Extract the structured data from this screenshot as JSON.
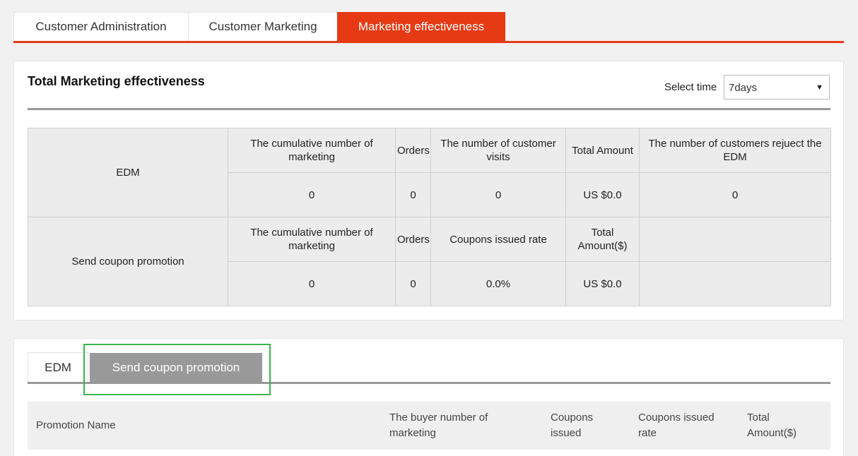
{
  "top_tabs": [
    {
      "label": "Customer Administration",
      "active": false
    },
    {
      "label": "Customer Marketing",
      "active": false
    },
    {
      "label": "Marketing effectiveness",
      "active": true
    }
  ],
  "summary_panel": {
    "title": "Total Marketing effectiveness",
    "select_label": "Select time",
    "select_value": "7days"
  },
  "summary_table": {
    "edm": {
      "label": "EDM",
      "headers": [
        "The cumulative number of marketing",
        "Orders",
        "The number of customer visits",
        "Total Amount",
        "The number of customers rejuect the EDM"
      ],
      "values": [
        "0",
        "0",
        "0",
        "US $0.0",
        "0"
      ]
    },
    "coupon": {
      "label": "Send coupon promotion",
      "headers": [
        "The cumulative number of marketing",
        "Orders",
        "Coupons issued rate",
        "Total Amount($)",
        ""
      ],
      "values": [
        "0",
        "0",
        "0.0%",
        "US $0.0",
        ""
      ]
    }
  },
  "detail_panel": {
    "tabs": [
      {
        "label": "EDM",
        "active": false
      },
      {
        "label": "Send coupon promotion",
        "active": true
      }
    ],
    "columns": [
      "Promotion Name",
      "The buyer number of marketing",
      "Coupons issued",
      "Coupons issued rate",
      "Total Amount($)"
    ]
  },
  "colors": {
    "accent": "#e63a14",
    "highlight": "#3bb54a"
  }
}
